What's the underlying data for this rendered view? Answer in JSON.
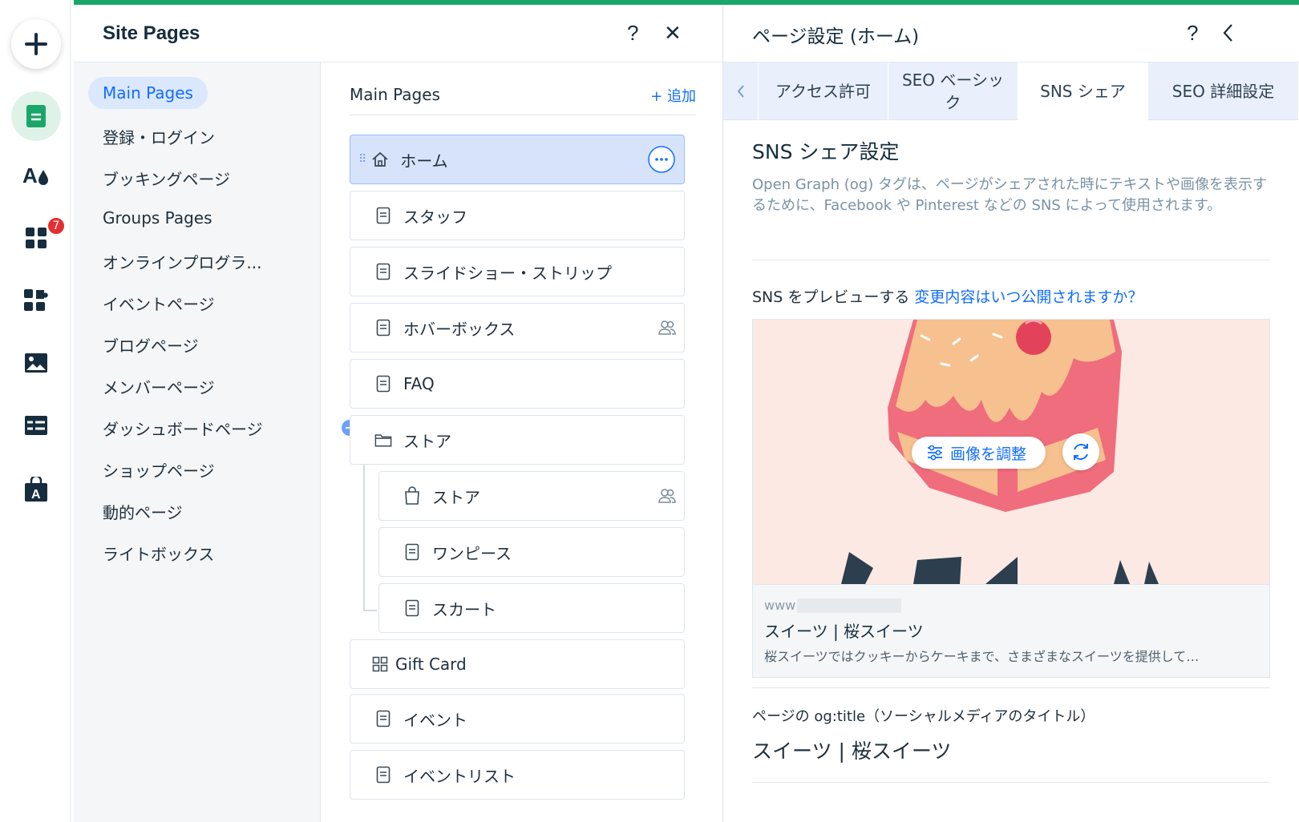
{
  "toolbar": {
    "items": [
      {
        "name": "add",
        "icon": "plus-icon"
      },
      {
        "name": "pages",
        "icon": "page-icon"
      },
      {
        "name": "design",
        "icon": "theme-icon"
      },
      {
        "name": "apps",
        "icon": "apps-grid-icon"
      },
      {
        "name": "business",
        "icon": "puzzle-icon"
      },
      {
        "name": "media",
        "icon": "image-icon"
      },
      {
        "name": "cms",
        "icon": "table-icon"
      },
      {
        "name": "app-market",
        "icon": "store-bag-icon"
      }
    ],
    "apps_badge": "7"
  },
  "colors": {
    "accent": "#116dff",
    "brand_green": "#1aa66a",
    "selected_bg": "#d6e3fb",
    "badge_red": "#e62e2e"
  },
  "site_pages": {
    "title": "Site Pages",
    "help_label": "?",
    "close_label": "✕",
    "categories": [
      "Main Pages",
      "登録・ログイン",
      "ブッキングページ",
      "Groups Pages",
      "オンラインプログラ...",
      "イベントページ",
      "ブログページ",
      "メンバーページ",
      "ダッシュボードページ",
      "ショップページ",
      "動的ページ",
      "ライトボックス"
    ],
    "active_category": "Main Pages",
    "list_title": "Main Pages",
    "add_label": "+ 追加",
    "pages": [
      {
        "label": "ホーム",
        "icon": "home-icon",
        "selected": true
      },
      {
        "label": "スタッフ",
        "icon": "page-icon"
      },
      {
        "label": "スライドショー・ストリップ",
        "icon": "page-icon"
      },
      {
        "label": "ホバーボックス",
        "icon": "page-icon",
        "members_only": true
      },
      {
        "label": "FAQ",
        "icon": "page-icon"
      },
      {
        "label": "ストア",
        "icon": "folder-icon"
      },
      {
        "label": "ストア",
        "icon": "bag-icon",
        "members_only": true,
        "child": true
      },
      {
        "label": "ワンピース",
        "icon": "page-icon",
        "child": true
      },
      {
        "label": "スカート",
        "icon": "page-icon",
        "child": true
      },
      {
        "label": "Gift Card",
        "icon": "gift-card-icon"
      },
      {
        "label": "イベント",
        "icon": "page-icon"
      },
      {
        "label": "イベントリスト",
        "icon": "page-icon"
      }
    ]
  },
  "page_settings": {
    "title": "ページ設定 (ホーム)",
    "help_label": "?",
    "tabs": [
      "アクセス許可",
      "SEO ベーシック",
      "SNS シェア",
      "SEO 詳細設定"
    ],
    "active_tab": "SNS シェア",
    "section_title": "SNS シェア設定",
    "description": "Open Graph (og) タグは、ページがシェアされた時にテキストや画像を表示するために、Facebook や Pinterest などの SNS によって使用されます。",
    "preview_label": "SNS をプレビューする",
    "preview_link": "変更内容はいつ公開されますか？",
    "adjust_image_label": "画像を調整",
    "image_caption_partial": "桜スイーツ",
    "preview_url": "www",
    "preview_title": "スイーツ | 桜スイーツ",
    "preview_description": "桜スイーツではクッキーからケーキまで、さまざまなスイーツを提供して…",
    "og_title_label": "ページの og:title（ソーシャルメディアのタイトル）",
    "og_title_value": "スイーツ | 桜スイーツ"
  }
}
